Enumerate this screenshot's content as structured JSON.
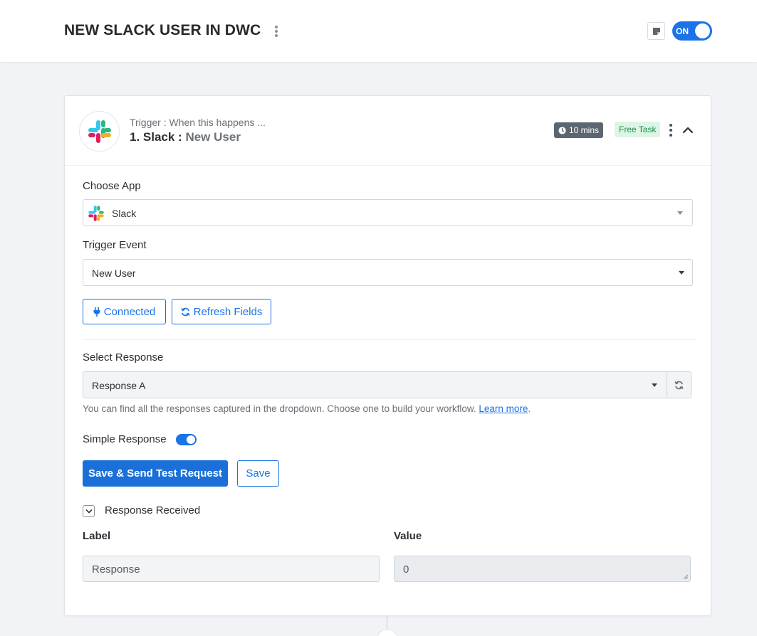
{
  "header": {
    "workflow_title": "NEW SLACK USER IN DWC",
    "toggle_label": "ON"
  },
  "step": {
    "trigger_caption": "Trigger : When this happens ...",
    "number_app": "1. Slack :",
    "event": "New User",
    "time_badge": "10 mins",
    "task_badge": "Free Task"
  },
  "form": {
    "choose_app_label": "Choose App",
    "choose_app_value": "Slack",
    "trigger_event_label": "Trigger Event",
    "trigger_event_value": "New User",
    "connected_label": "Connected",
    "refresh_fields_label": "Refresh Fields",
    "select_response_label": "Select Response",
    "select_response_value": "Response A",
    "help_text": "You can find all the responses captured in the dropdown. Choose one to build your workflow.",
    "help_link": "Learn more",
    "help_suffix": ".",
    "simple_response_label": "Simple Response",
    "save_send_label": "Save & Send Test Request",
    "save_label": "Save",
    "response_received_label": "Response Received",
    "col_label": "Label",
    "col_value": "Value",
    "row_label": "Response",
    "row_value": "0"
  },
  "colors": {
    "accent": "#1a73e8",
    "free_badge_bg": "#dcf6e6",
    "time_badge_bg": "#5c6670"
  }
}
